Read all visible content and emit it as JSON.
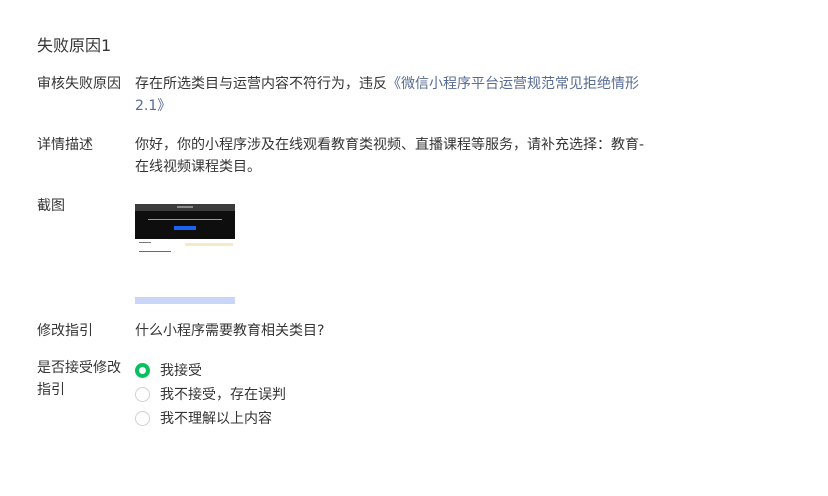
{
  "section_title": "失败原因1",
  "reason": {
    "label": "审核失败原因",
    "text": "存在所选类目与运营内容不符行为，违反",
    "link": "《微信小程序平台运营规范常见拒绝情形2.1》"
  },
  "detail": {
    "label": "详情描述",
    "text": "你好，你的小程序涉及在线观看教育类视频、直播课程等服务，请补充选择：教育-在线视频课程类目。"
  },
  "screenshot": {
    "label": "截图"
  },
  "guide": {
    "label": "修改指引",
    "link": "什么小程序需要教育相关类目?"
  },
  "accept": {
    "label": "是否接受修改指引",
    "options": [
      {
        "label": "我接受",
        "selected": true
      },
      {
        "label": "我不接受，存在误判",
        "selected": false
      },
      {
        "label": "我不理解以上内容",
        "selected": false
      }
    ]
  },
  "colors": {
    "link": "#576b95",
    "radio_selected": "#07c160",
    "text": "#353535"
  }
}
